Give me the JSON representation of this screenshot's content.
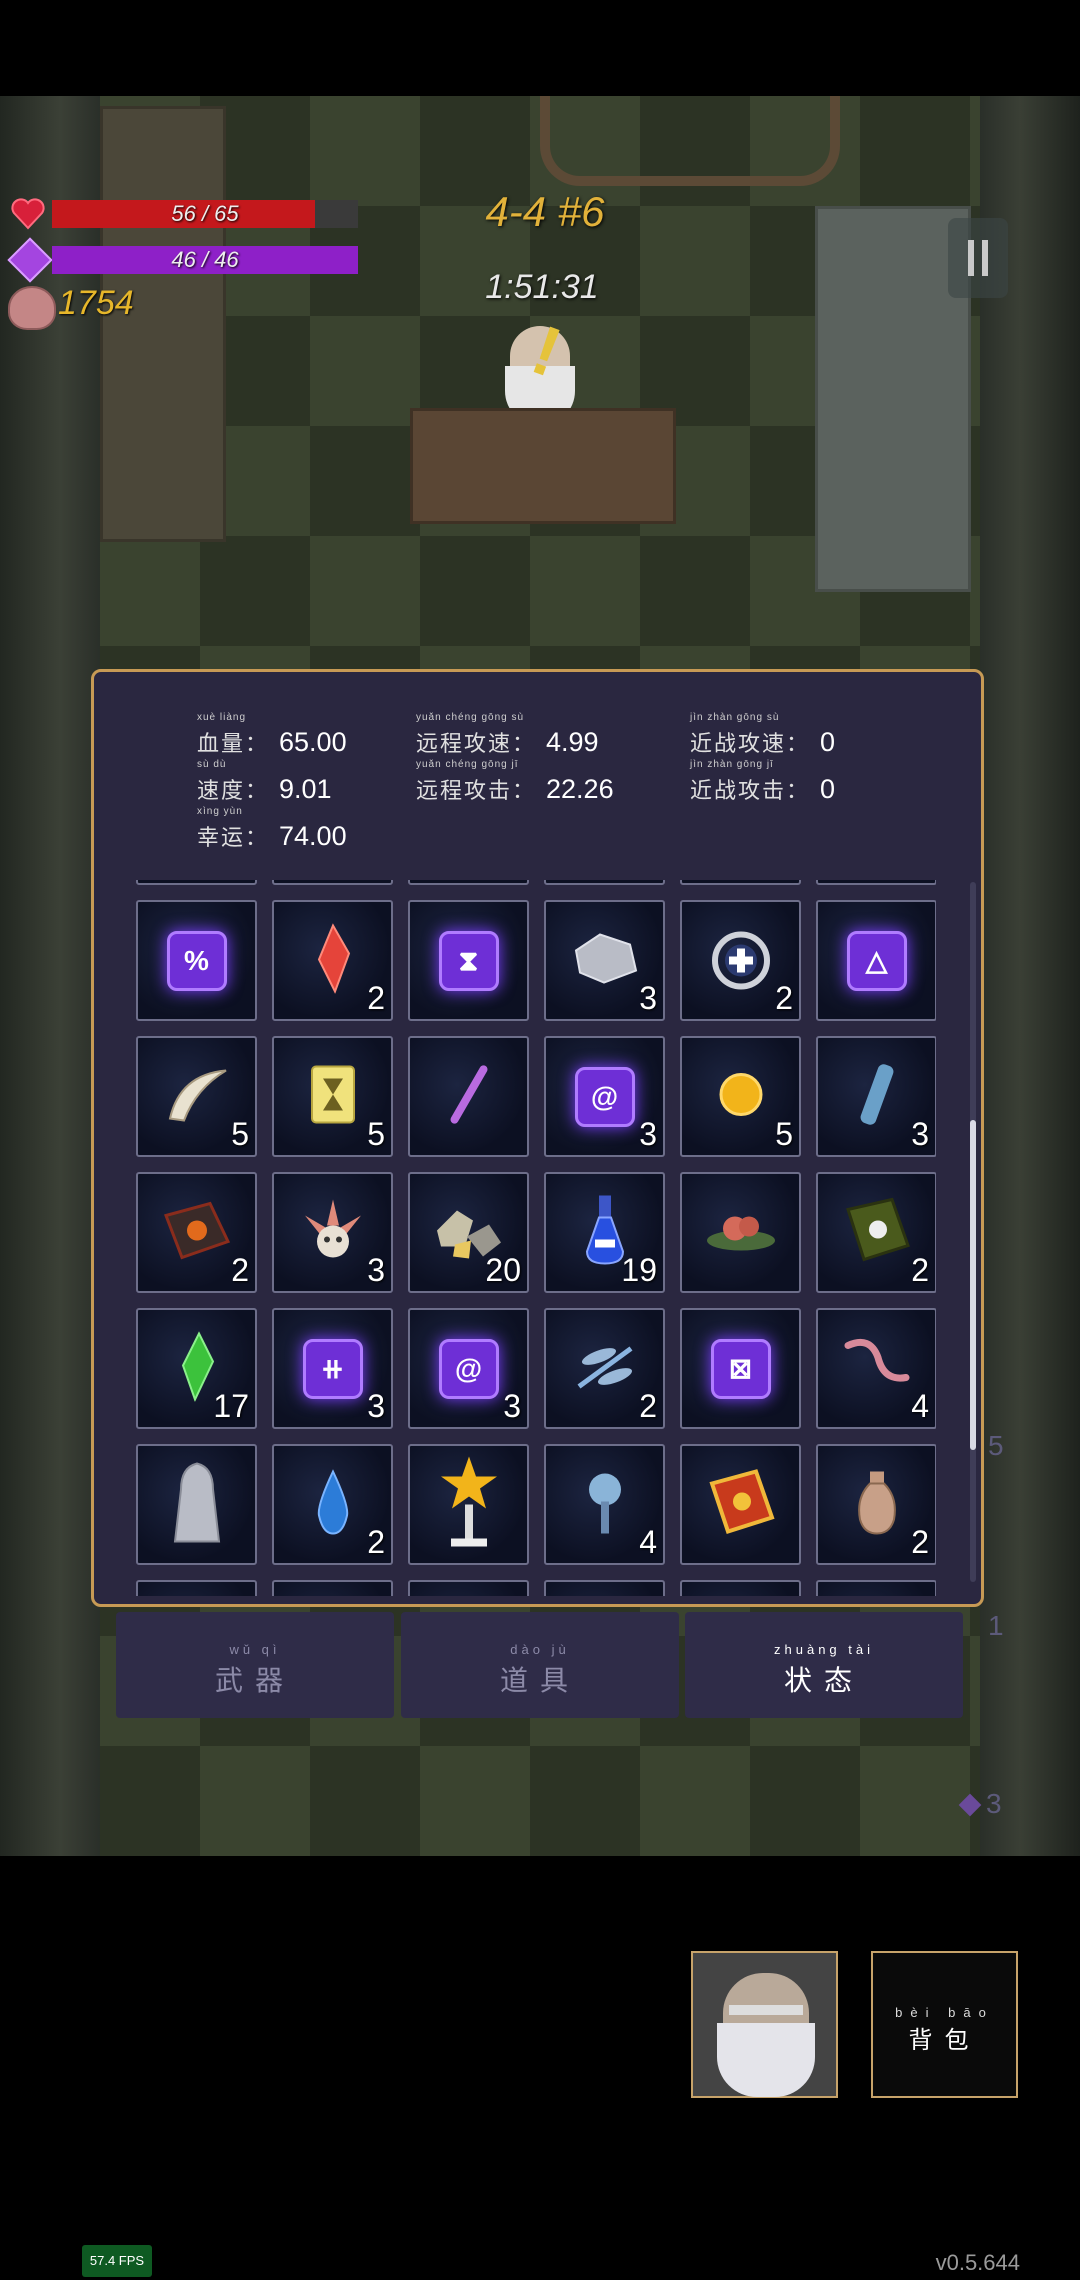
{
  "hud": {
    "hp_text": "56 / 65",
    "hp_fraction": 0.86,
    "mp_text": "46 / 46",
    "mp_fraction": 1.0,
    "gold": "1754",
    "level": "4-4 #6",
    "timer": "1:51:31"
  },
  "stats": [
    {
      "pinyin": "xuè liàng",
      "label": "血量：",
      "value": "65.00"
    },
    {
      "pinyin": "yuǎn chéng gōng sù",
      "label": "远程攻速：",
      "value": "4.99"
    },
    {
      "pinyin": "jìn zhàn gōng sù",
      "label": "近战攻速：",
      "value": "0"
    },
    {
      "pinyin": "sù dù",
      "label": "速度：",
      "value": "9.01"
    },
    {
      "pinyin": "yuǎn chéng gōng jī",
      "label": "远程攻击：",
      "value": "22.26"
    },
    {
      "pinyin": "jìn zhàn gōng jī",
      "label": "近战攻击：",
      "value": "0"
    },
    {
      "pinyin": "xìng yùn",
      "label": "幸运：",
      "value": "74.00"
    }
  ],
  "inventory": [
    [
      {
        "icon": "percent-rune-icon",
        "glyph": "%",
        "count": ""
      },
      {
        "icon": "red-crystal-icon",
        "count": "2"
      },
      {
        "icon": "hourglass-rune-icon",
        "glyph": "⧗",
        "count": ""
      },
      {
        "icon": "silver-ore-icon",
        "count": "3"
      },
      {
        "icon": "healing-ring-icon",
        "count": "2"
      },
      {
        "icon": "triangle-rune-icon",
        "glyph": "△",
        "count": ""
      }
    ],
    [
      {
        "icon": "horn-icon",
        "count": "5"
      },
      {
        "icon": "yellow-card-icon",
        "count": "5"
      },
      {
        "icon": "purple-wand-icon",
        "count": ""
      },
      {
        "icon": "spiral-rune-icon",
        "glyph": "@",
        "count": "3"
      },
      {
        "icon": "gold-coin-icon",
        "count": "5"
      },
      {
        "icon": "blue-vial-icon",
        "count": "3"
      }
    ],
    [
      {
        "icon": "fire-book-icon",
        "count": "2"
      },
      {
        "icon": "feather-skull-icon",
        "count": "3"
      },
      {
        "icon": "rock-chunks-icon",
        "count": "20"
      },
      {
        "icon": "blue-potion-icon",
        "count": "19"
      },
      {
        "icon": "red-flower-icon",
        "count": ""
      },
      {
        "icon": "green-skull-book-icon",
        "count": "2"
      }
    ],
    [
      {
        "icon": "green-crystal-icon",
        "count": "17"
      },
      {
        "icon": "cross-rune-icon",
        "glyph": "⧺",
        "count": "3"
      },
      {
        "icon": "spiral-rune-icon",
        "glyph": "@",
        "count": "3"
      },
      {
        "icon": "dragonfly-icon",
        "count": "2"
      },
      {
        "icon": "x-rune-icon",
        "glyph": "⊠",
        "count": ""
      },
      {
        "icon": "worm-icon",
        "count": "4"
      }
    ],
    [
      {
        "icon": "hooded-statue-icon",
        "count": ""
      },
      {
        "icon": "water-drop-icon",
        "count": "2"
      },
      {
        "icon": "star-trophy-icon",
        "count": ""
      },
      {
        "icon": "blue-flower-icon",
        "count": "4"
      },
      {
        "icon": "gold-book-icon",
        "count": ""
      },
      {
        "icon": "clay-jar-icon",
        "count": "2"
      }
    ]
  ],
  "tabs": [
    {
      "pinyin": "wǔ qì",
      "label": "武器",
      "active": false
    },
    {
      "pinyin": "dào jù",
      "label": "道具",
      "active": false
    },
    {
      "pinyin": "zhuàng tài",
      "label": "状态",
      "active": true
    }
  ],
  "side_numbers": [
    "5",
    "1",
    "3"
  ],
  "bag": {
    "pinyin": "bèi bāo",
    "label": "背包"
  },
  "fps": "57.4 FPS",
  "version": "v0.5.644",
  "colors": {
    "hp": "#c4181c",
    "mp": "#8e20c8",
    "gold": "#e7b72a",
    "panel_border": "#c79a55",
    "panel_bg": "#2a2740"
  }
}
